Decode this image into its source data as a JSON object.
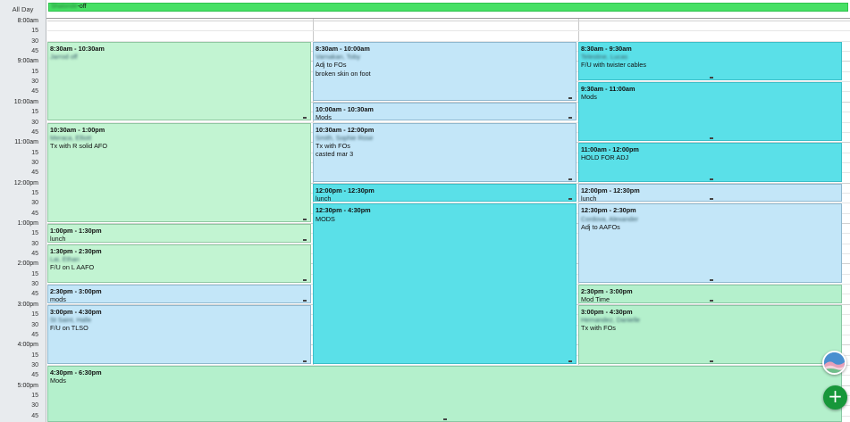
{
  "all_day": {
    "label": "All Day",
    "event": {
      "name": "Shalonde",
      "suffix": "-off"
    }
  },
  "time_labels": [
    "8:00am",
    "15",
    "30",
    "45",
    "9:00am",
    "15",
    "30",
    "45",
    "10:00am",
    "15",
    "30",
    "45",
    "11:00am",
    "15",
    "30",
    "45",
    "12:00pm",
    "15",
    "30",
    "45",
    "1:00pm",
    "15",
    "30",
    "45",
    "2:00pm",
    "15",
    "30",
    "45",
    "3:00pm",
    "15",
    "30",
    "45",
    "4:00pm",
    "15",
    "30",
    "45",
    "5:00pm",
    "15",
    "30",
    "45"
  ],
  "events": [
    {
      "id": "c1-a",
      "time": "8:30am - 10:30am",
      "name": "Jarrod off",
      "lines": []
    },
    {
      "id": "c1-b",
      "time": "10:30am - 1:00pm",
      "name": "Meraca, Elliott",
      "lines": [
        "Tx with R solid AFO"
      ]
    },
    {
      "id": "c1-c",
      "time": "1:00pm - 1:30pm",
      "name": "",
      "lines": [
        "lunch"
      ]
    },
    {
      "id": "c1-d",
      "time": "1:30pm - 2:30pm",
      "name": "Lai, Ethan",
      "lines": [
        "F/U on L AAFO"
      ]
    },
    {
      "id": "c1-e",
      "time": "2:30pm - 3:00pm",
      "name": "",
      "lines": [
        "mods"
      ]
    },
    {
      "id": "c1-f",
      "time": "3:00pm - 4:30pm",
      "name": "St Saint, Halle",
      "lines": [
        "F/U on TLSO"
      ]
    },
    {
      "id": "c1-g",
      "time": "4:30pm - 6:30pm",
      "name": "",
      "lines": [
        "Mods"
      ]
    },
    {
      "id": "c2-a",
      "time": "8:30am - 10:00am",
      "name": "Varnakan, Toby",
      "lines": [
        "Adj to FOs",
        "broken skin on foot"
      ]
    },
    {
      "id": "c2-b",
      "time": "10:00am - 10:30am",
      "name": "",
      "lines": [
        "Mods"
      ]
    },
    {
      "id": "c2-c",
      "time": "10:30am - 12:00pm",
      "name": "Smith, Sophie Rose",
      "lines": [
        "Tx with FOs",
        "casted mar 3"
      ]
    },
    {
      "id": "c2-d",
      "time": "12:00pm - 12:30pm",
      "name": "",
      "lines": [
        "lunch"
      ]
    },
    {
      "id": "c2-e",
      "time": "12:30pm - 4:30pm",
      "name": "",
      "lines": [
        "MODS"
      ]
    },
    {
      "id": "c3-a",
      "time": "8:30am - 9:30am",
      "name": "Telestine, Lucas",
      "lines": [
        "F/U with twister cables"
      ]
    },
    {
      "id": "c3-b",
      "time": "9:30am - 11:00am",
      "name": "",
      "lines": [
        "Mods"
      ]
    },
    {
      "id": "c3-c",
      "time": "11:00am - 12:00pm",
      "name": "",
      "lines": [
        "HOLD FOR ADJ"
      ]
    },
    {
      "id": "c3-d",
      "time": "12:00pm - 12:30pm",
      "name": "",
      "lines": [
        "lunch"
      ]
    },
    {
      "id": "c3-e",
      "time": "12:30pm - 2:30pm",
      "name": "Cordova, Alexander",
      "lines": [
        "Adj to AAFOs"
      ]
    },
    {
      "id": "c3-f",
      "time": "2:30pm - 3:00pm",
      "name": "",
      "lines": [
        "Mod Time"
      ]
    },
    {
      "id": "c3-g",
      "time": "3:00pm - 4:30pm",
      "name": "Hernandez, Danielle",
      "lines": [
        "Tx with FOs"
      ]
    }
  ],
  "colors": {
    "green": "#c2f4d2",
    "blue": "#c3e6f8",
    "cyan": "#5ae0e8",
    "all_day_event": "#46e064",
    "add_button": "#17973a"
  },
  "icons": {
    "fab_top": "profile-avatar-icon",
    "fab_bottom": "plus-icon"
  }
}
